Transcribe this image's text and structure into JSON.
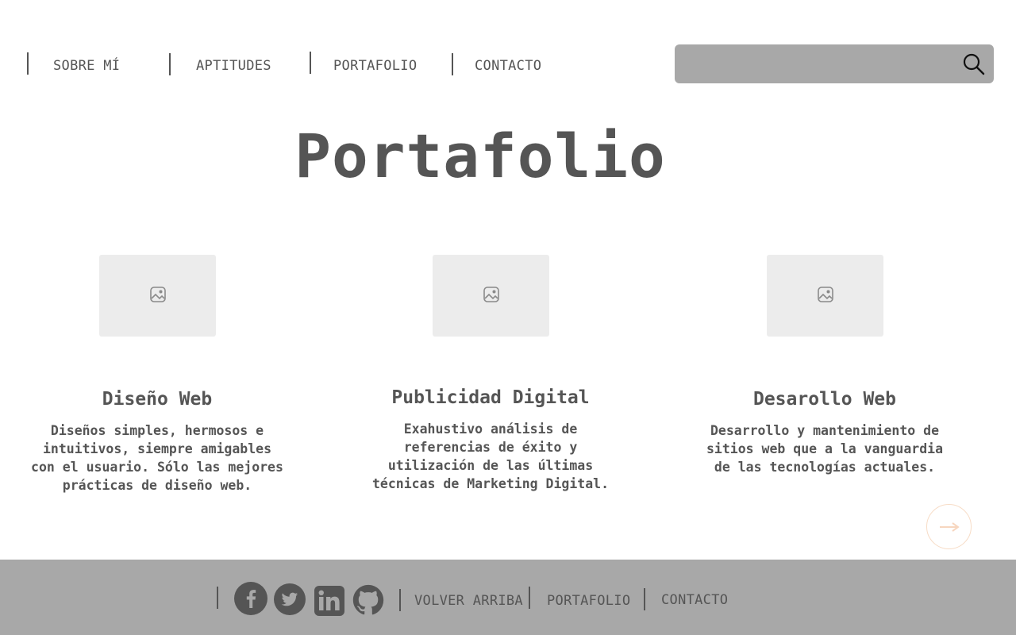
{
  "nav": {
    "items": [
      {
        "label": "SOBRE MÍ"
      },
      {
        "label": "APTITUDES"
      },
      {
        "label": "PORTAFOLIO"
      },
      {
        "label": "CONTACTO"
      }
    ],
    "search": {
      "placeholder": "",
      "value": "",
      "icon": "search-icon"
    }
  },
  "main": {
    "title": "Portafolio",
    "cards": [
      {
        "image_icon": "image-placeholder-icon",
        "title": "Diseño Web",
        "description": "Diseños simples, hermosos e intuitivos, siempre amigables con el usuario. Sólo las mejores prácticas de diseño web."
      },
      {
        "image_icon": "image-placeholder-icon",
        "title": "Publicidad Digital",
        "description": "Exahustivo análisis de referencias de éxito y utilización de las últimas técnicas de Marketing Digital."
      },
      {
        "image_icon": "image-placeholder-icon",
        "title": "Desarollo Web",
        "description": "Desarrollo y mantenimiento de sitios web que a la vanguardia de las tecnologías actuales."
      }
    ],
    "next_icon": "arrow-right-icon"
  },
  "footer": {
    "social": [
      {
        "icon": "facebook-icon"
      },
      {
        "icon": "twitter-icon"
      },
      {
        "icon": "linkedin-icon"
      },
      {
        "icon": "github-icon"
      }
    ],
    "links": [
      {
        "label": "VOLVER ARRIBA"
      },
      {
        "label": "PORTAFOLIO"
      },
      {
        "label": "CONTACTO"
      }
    ]
  },
  "colors": {
    "text": "#555555",
    "footer_bg": "#a8a8a8",
    "search_bg": "#a8a8a8",
    "card_image_bg": "#ececec",
    "next_button_border": "#f7dcc6"
  }
}
